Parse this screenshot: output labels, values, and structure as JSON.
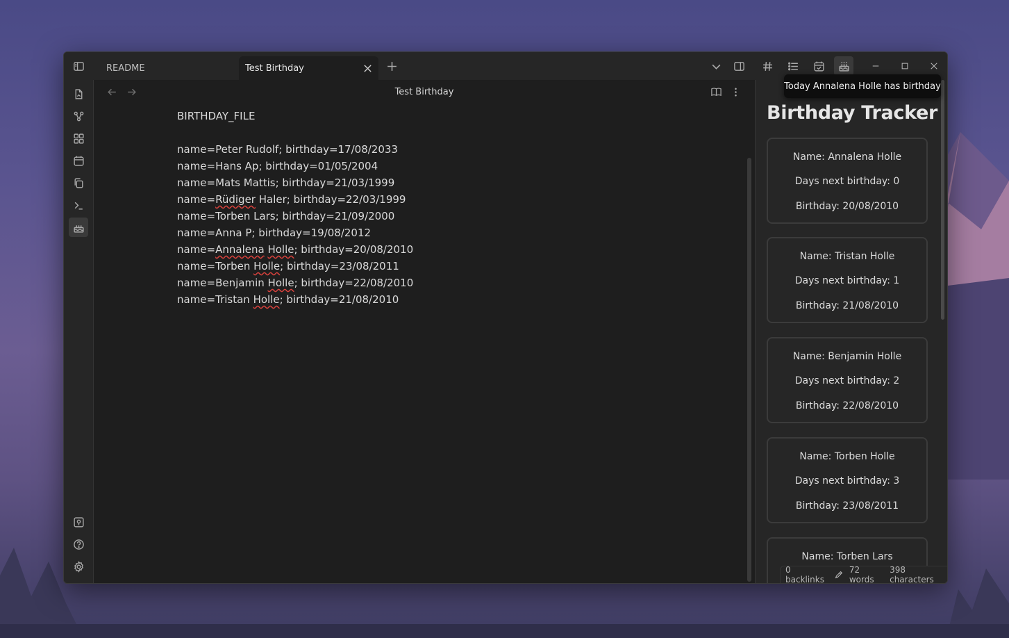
{
  "tabs": [
    {
      "label": "README",
      "active": false
    },
    {
      "label": "Test Birthday",
      "active": true
    }
  ],
  "view": {
    "title": "Test Birthday"
  },
  "document": {
    "lines": [
      "BIRTHDAY_FILE",
      "",
      "name=Peter Rudolf; birthday=17/08/2033",
      "name=Hans Ap; birthday=01/05/2004",
      "name=Mats Mattis; birthday=21/03/1999",
      "name=Rüdiger Haler; birthday=22/03/1999",
      "name=Torben Lars; birthday=21/09/2000",
      "name=Anna P; birthday=19/08/2012",
      "name=Annalena Holle; birthday=20/08/2010",
      "name=Torben Holle; birthday=23/08/2011",
      "name=Benjamin Holle; birthday=22/08/2010",
      "name=Tristan Holle; birthday=21/08/2010"
    ]
  },
  "panel": {
    "title": "Birthday Tracker",
    "cards": [
      {
        "name": "Name: Annalena Holle",
        "days": "Days next birthday: 0",
        "birthday": "Birthday: 20/08/2010"
      },
      {
        "name": "Name: Tristan Holle",
        "days": "Days next birthday: 1",
        "birthday": "Birthday: 21/08/2010"
      },
      {
        "name": "Name: Benjamin Holle",
        "days": "Days next birthday: 2",
        "birthday": "Birthday: 22/08/2010"
      },
      {
        "name": "Name: Torben Holle",
        "days": "Days next birthday: 3",
        "birthday": "Birthday: 23/08/2011"
      },
      {
        "name": "Name: Torben Lars",
        "days": "",
        "birthday": ""
      }
    ]
  },
  "tooltip": "Today Annalena Holle has birthday",
  "status": {
    "backlinks": "0 backlinks",
    "words": "72 words",
    "characters": "398 characters"
  },
  "icons": {
    "ribbon_top": [
      "file-icon",
      "graph-icon",
      "canvas-icon",
      "calendar-icon",
      "copy-icon",
      "terminal-icon",
      "cake-icon"
    ],
    "ribbon_bottom": [
      "vault-icon",
      "help-icon",
      "settings-icon"
    ],
    "toolbar": [
      "chevron-down-icon",
      "split-pane-icon",
      "hashtag-icon",
      "list-icon",
      "calendar-check-icon",
      "cake-icon"
    ]
  },
  "colors": {
    "background": "#1e1e1e",
    "panel": "#262626",
    "text": "#dadada",
    "spellcheck": "#d9413c"
  }
}
